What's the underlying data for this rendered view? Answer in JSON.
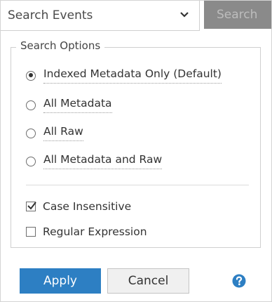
{
  "search": {
    "placeholder": "Search Events",
    "button_label": "Search"
  },
  "options": {
    "legend": "Search Options",
    "radios": [
      {
        "label": "Indexed Metadata Only (Default)",
        "checked": true
      },
      {
        "label": "All Metadata",
        "checked": false
      },
      {
        "label": "All Raw",
        "checked": false
      },
      {
        "label": "All Metadata and Raw",
        "checked": false
      }
    ],
    "checkboxes": [
      {
        "label": "Case Insensitive",
        "checked": true
      },
      {
        "label": "Regular Expression",
        "checked": false
      }
    ]
  },
  "footer": {
    "apply_label": "Apply",
    "cancel_label": "Cancel",
    "help_icon": "question-circle-icon"
  },
  "colors": {
    "accent": "#2d7fc3",
    "search_button_bg": "#8a8a8a"
  }
}
